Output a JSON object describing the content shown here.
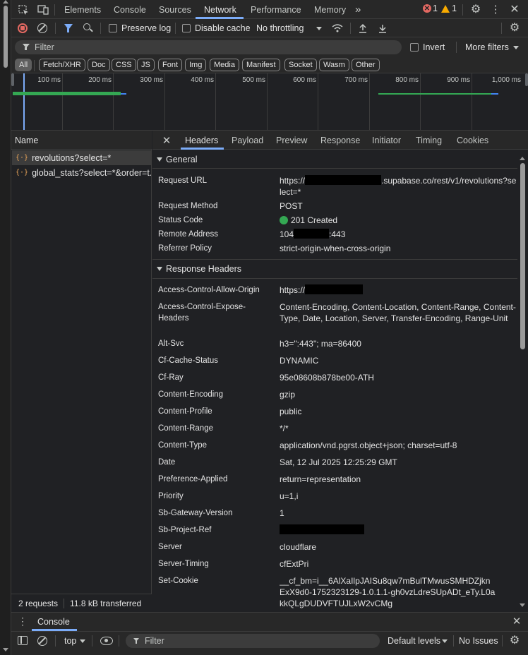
{
  "tabs": [
    "Elements",
    "Console",
    "Sources",
    "Network",
    "Performance",
    "Memory"
  ],
  "active_tab": "Network",
  "error_count": "1",
  "warning_count": "1",
  "toolbar": {
    "preserve_log": "Preserve log",
    "disable_cache": "Disable cache",
    "throttling": "No throttling"
  },
  "filter": {
    "placeholder": "Filter",
    "invert": "Invert",
    "more_filters": "More filters"
  },
  "type_filters": [
    "All",
    "Fetch/XHR",
    "Doc",
    "CSS",
    "JS",
    "Font",
    "Img",
    "Media",
    "Manifest",
    "Socket",
    "Wasm",
    "Other"
  ],
  "timeline_ticks": [
    "100 ms",
    "200 ms",
    "300 ms",
    "400 ms",
    "500 ms",
    "600 ms",
    "700 ms",
    "800 ms",
    "900 ms",
    "1,000 ms"
  ],
  "name_column": "Name",
  "requests": [
    "revolutions?select=*",
    "global_stats?select=*&order=t..."
  ],
  "status": {
    "requests": "2 requests",
    "transferred": "11.8 kB transferred"
  },
  "detail_tabs": [
    "Headers",
    "Payload",
    "Preview",
    "Response",
    "Initiator",
    "Timing",
    "Cookies"
  ],
  "general": {
    "title": "General",
    "request_url_label": "Request URL",
    "request_url_prefix": "https://",
    "request_url_suffix": ".supabase.co/rest/v1/revolutions?select=*",
    "method_label": "Request Method",
    "method": "POST",
    "status_label": "Status Code",
    "status": "201 Created",
    "status_color": "#34a853",
    "remote_label": "Remote Address",
    "remote_prefix": "104",
    "remote_suffix": ":443",
    "referrer_label": "Referrer Policy",
    "referrer": "strict-origin-when-cross-origin"
  },
  "response_headers": {
    "title": "Response Headers",
    "acao_label": "Access-Control-Allow-Origin",
    "acao_prefix": "https://",
    "aceh_label": "Access-Control-Expose-Headers",
    "aceh": "Content-Encoding, Content-Location, Content-Range, Content-Type, Date, Location, Server, Transfer-Encoding, Range-Unit",
    "alt_svc_label": "Alt-Svc",
    "alt_svc": "h3=\":443\"; ma=86400",
    "cf_cache_label": "Cf-Cache-Status",
    "cf_cache": "DYNAMIC",
    "cf_ray_label": "Cf-Ray",
    "cf_ray": "95e08608b878be00-ATH",
    "enc_label": "Content-Encoding",
    "enc": "gzip",
    "profile_label": "Content-Profile",
    "profile": "public",
    "range_label": "Content-Range",
    "range": "*/*",
    "ctype_label": "Content-Type",
    "ctype": "application/vnd.pgrst.object+json; charset=utf-8",
    "date_label": "Date",
    "date": "Sat, 12 Jul 2025 12:25:29 GMT",
    "pref_label": "Preference-Applied",
    "pref": "return=representation",
    "priority_label": "Priority",
    "priority": "u=1,i",
    "sbgw_label": "Sb-Gateway-Version",
    "sbgw": "1",
    "sbref_label": "Sb-Project-Ref",
    "server_label": "Server",
    "server": "cloudflare",
    "timing_label": "Server-Timing",
    "timing": "cfExtPri",
    "cookie_label": "Set-Cookie",
    "cookie": "__cf_bm=i__6AlXaIlpJAISu8qw7mBulTMwusSMHDZjknExX9d0-1752323129-1.0.1.1-gh0vzLdreSUpADt_eTy.L0akkQLgDUDVFTUJLxW2vCMg"
  },
  "drawer": {
    "title": "Console",
    "context": "top",
    "filter_placeholder": "Filter",
    "levels": "Default levels",
    "issues": "No Issues"
  }
}
